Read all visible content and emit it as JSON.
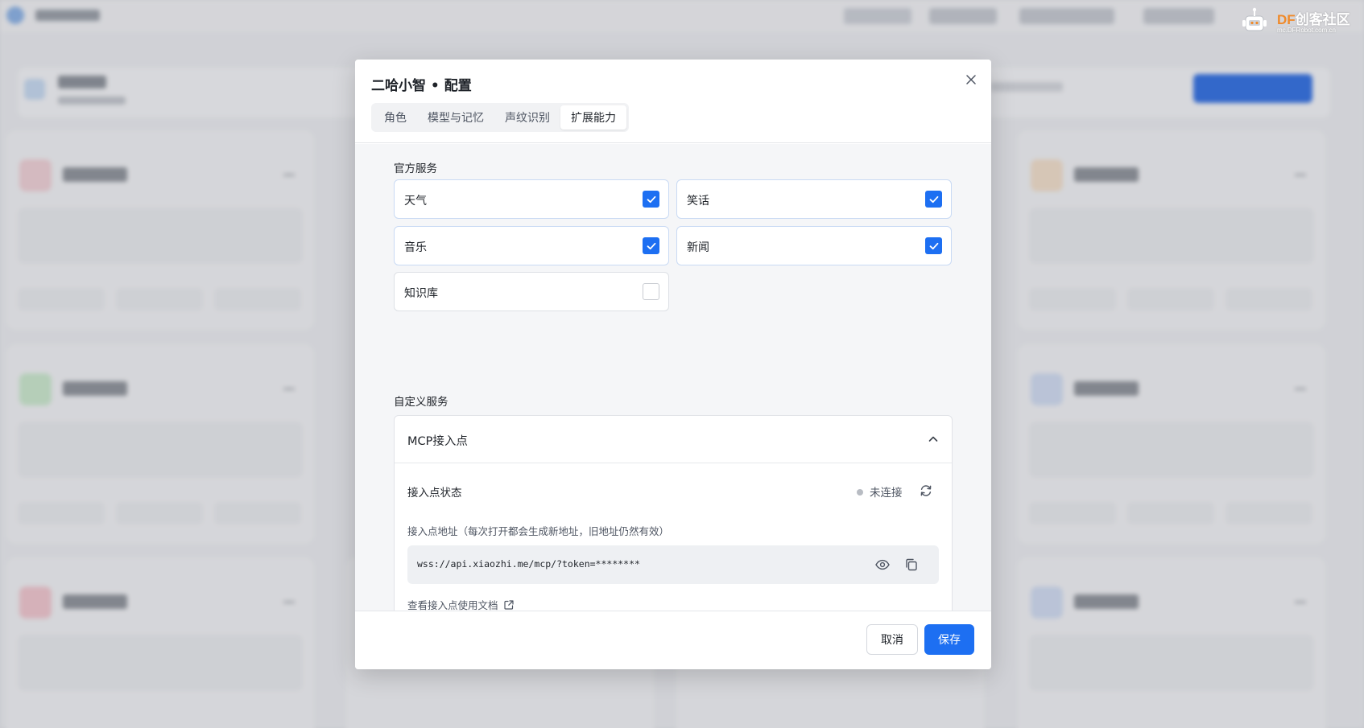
{
  "modal": {
    "title": "二哈小智 • 配置",
    "tabs": [
      {
        "label": "角色",
        "active": false
      },
      {
        "label": "模型与记忆",
        "active": false
      },
      {
        "label": "声纹识别",
        "active": false
      },
      {
        "label": "扩展能力",
        "active": true
      }
    ],
    "official_services": {
      "heading": "官方服务",
      "items": [
        {
          "label": "天气",
          "checked": true
        },
        {
          "label": "笑话",
          "checked": true
        },
        {
          "label": "音乐",
          "checked": true
        },
        {
          "label": "新闻",
          "checked": true
        },
        {
          "label": "知识库",
          "checked": false
        }
      ]
    },
    "custom_services": {
      "heading": "自定义服务",
      "mcp": {
        "title": "MCP接入点",
        "expanded": true,
        "status_label": "接入点状态",
        "status_value": "未连接",
        "address_label": "接入点地址（每次打开都会生成新地址，旧地址仍然有效）",
        "address_value": "wss://api.xiaozhi.me/mcp/?token=********",
        "doc_link": "查看接入点使用文档"
      }
    },
    "footer": {
      "cancel_label": "取消",
      "save_label": "保存"
    }
  },
  "watermark": {
    "brand_latin": "DF",
    "brand_cn": "创客社区",
    "url": "mc.DFRobot.com.cn"
  },
  "colors": {
    "accent": "#1d6ff2",
    "watermark_orange": "#f08a2a",
    "status_dot": "#b8bcc3"
  },
  "icons": {
    "close": "close-icon",
    "check": "check-icon",
    "chevron": "chevron-up-icon",
    "refresh": "refresh-icon",
    "eye": "eye-icon",
    "copy": "copy-icon",
    "external": "external-link-icon"
  }
}
